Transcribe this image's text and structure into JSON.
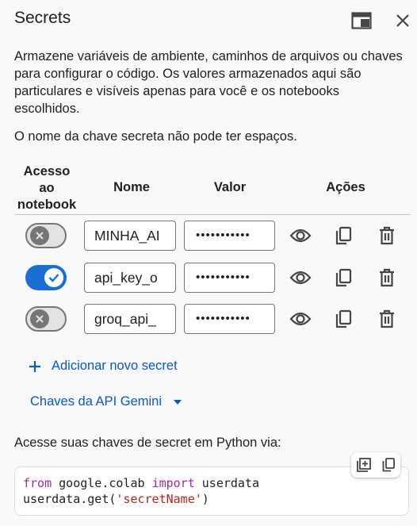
{
  "panel": {
    "title": "Secrets"
  },
  "description": "Armazene variáveis de ambiente, caminhos de arquivos ou chaves para configurar o código. Os valores armazenados aqui são particulares e visíveis apenas para você e os notebooks escolhidos.",
  "warning": "O nome da chave secreta não pode ter espaços.",
  "columns": {
    "access": [
      "Acesso",
      "ao",
      "notebook"
    ],
    "name": "Nome",
    "value": "Valor",
    "actions": "Ações"
  },
  "secrets": [
    {
      "name": "MINHA_AI",
      "value": "•••••••••••",
      "access": false
    },
    {
      "name": "api_key_o",
      "value": "•••••••••••",
      "access": true
    },
    {
      "name": "groq_api_",
      "value": "•••••••••••",
      "access": false
    }
  ],
  "add_secret": {
    "icon": "plus-icon",
    "label": "Adicionar novo secret"
  },
  "gemini": {
    "label": "Chaves da API Gemini",
    "icon": "caret-down-icon"
  },
  "access_text": "Acesse suas chaves de secret em Python via:",
  "code": {
    "line1": {
      "kw1": "from",
      "mod": " google.colab ",
      "kw2": "import",
      "rest": " userdata"
    },
    "line2": {
      "pre": "userdata.get(",
      "str": "'secretName'",
      "post": ")"
    }
  },
  "colors": {
    "accent": "#0b57d0",
    "toggle_on": "#1a6fd4",
    "keyword": "#a626a4",
    "string": "#b3261e"
  }
}
